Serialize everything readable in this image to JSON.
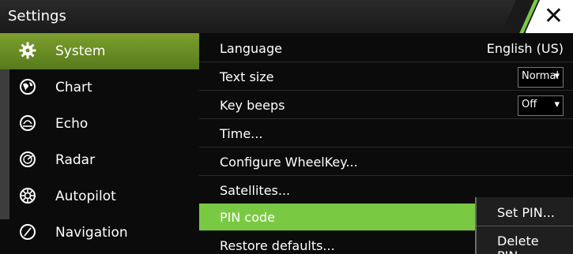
{
  "window": {
    "title": "Settings"
  },
  "sidebar": {
    "items": [
      {
        "label": "System",
        "icon": "gear-icon",
        "active": true
      },
      {
        "label": "Chart",
        "icon": "globe-icon"
      },
      {
        "label": "Echo",
        "icon": "echo-icon"
      },
      {
        "label": "Radar",
        "icon": "radar-icon"
      },
      {
        "label": "Autopilot",
        "icon": "helm-icon"
      },
      {
        "label": "Navigation",
        "icon": "compass-icon"
      }
    ]
  },
  "settings": {
    "rows": [
      {
        "label": "Language",
        "value": "English (US)"
      },
      {
        "label": "Text size",
        "value": "Normal"
      },
      {
        "label": "Key beeps",
        "value": "Off"
      },
      {
        "label": "Time..."
      },
      {
        "label": "Configure WheelKey..."
      },
      {
        "label": "Satellites..."
      },
      {
        "label": "PIN code",
        "selected": true
      },
      {
        "label": "Restore defaults..."
      }
    ]
  },
  "submenu": {
    "items": [
      {
        "label": "Set PIN..."
      },
      {
        "label": "Delete PIN..."
      }
    ]
  },
  "colors": {
    "accent": "#7ac943",
    "active_sidebar": "#6a8d25",
    "background": "#0b0b0b"
  }
}
